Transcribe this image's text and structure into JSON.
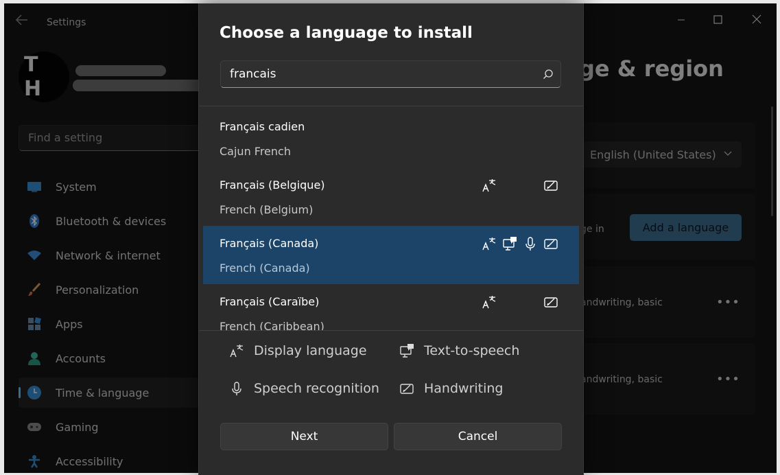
{
  "app": {
    "title": "Settings"
  },
  "profile": {
    "initials": "T H"
  },
  "search": {
    "placeholder": "Find a setting"
  },
  "sidebar": {
    "items": [
      {
        "label": "System",
        "icon": "monitor-icon"
      },
      {
        "label": "Bluetooth & devices",
        "icon": "bluetooth-icon"
      },
      {
        "label": "Network & internet",
        "icon": "wifi-icon"
      },
      {
        "label": "Personalization",
        "icon": "brush-icon"
      },
      {
        "label": "Apps",
        "icon": "apps-icon"
      },
      {
        "label": "Accounts",
        "icon": "person-icon"
      },
      {
        "label": "Time & language",
        "icon": "globe-clock-icon",
        "active": true
      },
      {
        "label": "Gaming",
        "icon": "gamepad-icon"
      },
      {
        "label": "Accessibility",
        "icon": "accessibility-icon"
      }
    ]
  },
  "content": {
    "title_partial": "ge & region",
    "windows_display_language": "English (United States)",
    "preferred_text_partial": "ge in",
    "add_language_label": "Add a language",
    "lang_row1_text": "andwriting, basic",
    "lang_row2_text": "andwriting, basic",
    "more_label": "•••"
  },
  "dialog": {
    "title": "Choose a language to install",
    "search_value": "francais",
    "languages": [
      {
        "native": "Français cadien",
        "english": "Cajun French",
        "display": false,
        "tts": false,
        "speech": false,
        "handwriting": false,
        "selected": false
      },
      {
        "native": "Français (Belgique)",
        "english": "French (Belgium)",
        "display": true,
        "tts": false,
        "speech": false,
        "handwriting": true,
        "selected": false
      },
      {
        "native": "Français (Canada)",
        "english": "French (Canada)",
        "display": true,
        "tts": true,
        "speech": true,
        "handwriting": true,
        "selected": true
      },
      {
        "native": "Français (Caraïbe)",
        "english": "French (Caribbean)",
        "display": true,
        "tts": false,
        "speech": false,
        "handwriting": true,
        "selected": false
      }
    ],
    "legend": {
      "display": "Display language",
      "tts": "Text-to-speech",
      "speech": "Speech recognition",
      "handwriting": "Handwriting"
    },
    "next_label": "Next",
    "cancel_label": "Cancel"
  },
  "colors": {
    "accent": "#60cdff",
    "selected_row": "#1b4468",
    "add_button": "#3d6e90"
  }
}
